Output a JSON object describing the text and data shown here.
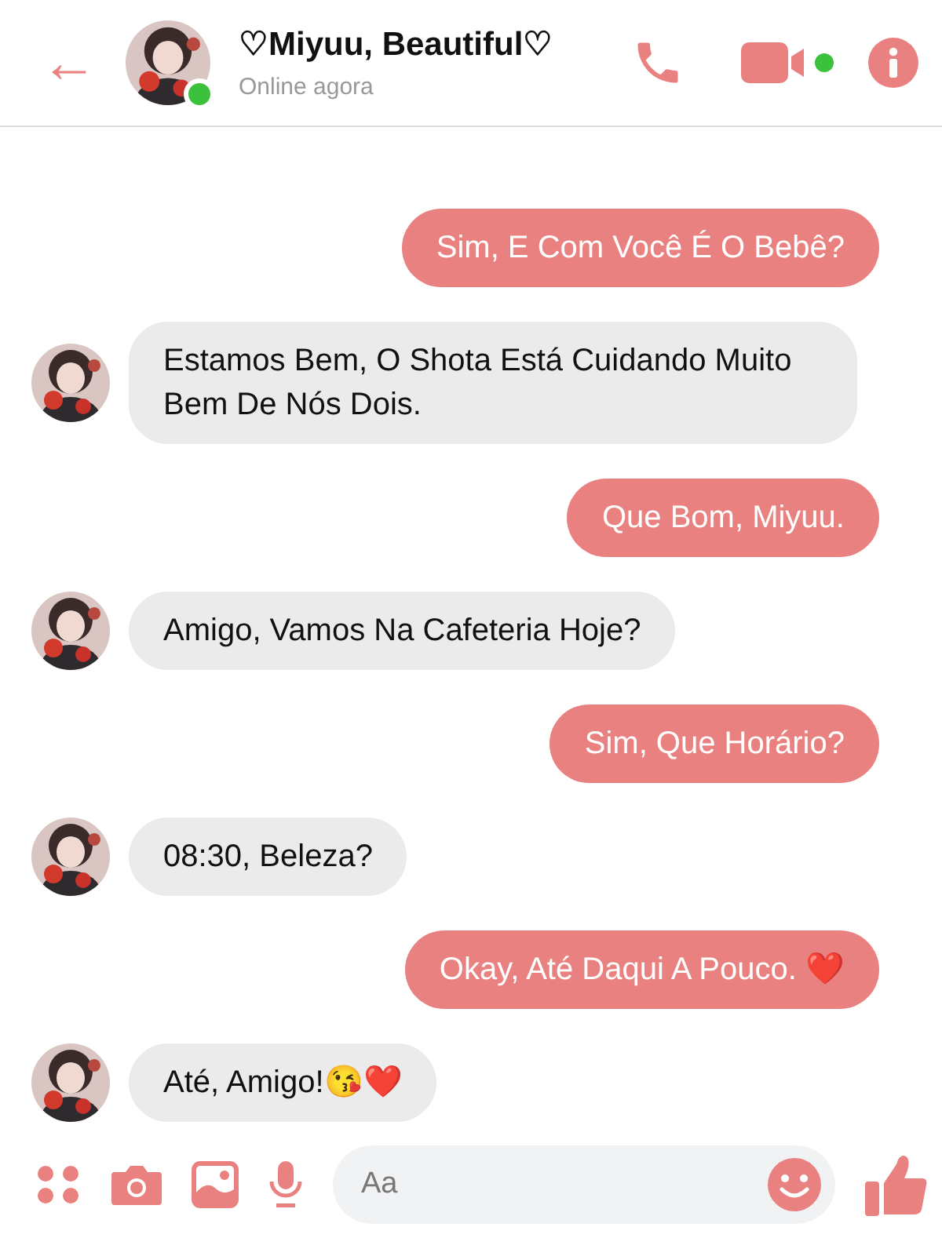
{
  "header": {
    "back": "←",
    "name": "♡Miyuu, Beautiful♡",
    "status": "Online agora",
    "online": true,
    "video_active": true
  },
  "messages": [
    {
      "kind": "sent",
      "text": "Sim, E Com Você É O Bebê?"
    },
    {
      "kind": "received",
      "text": "Estamos Bem, O Shota Está Cuidando Muito Bem De Nós Dois."
    },
    {
      "kind": "sent",
      "text": "Que Bom, Miyuu."
    },
    {
      "kind": "received",
      "text": "Amigo, Vamos Na Cafeteria Hoje?"
    },
    {
      "kind": "sent",
      "text": "Sim, Que Horário?"
    },
    {
      "kind": "received",
      "text": "08:30, Beleza?"
    },
    {
      "kind": "sent",
      "text": "Okay, Até Daqui A Pouco. ❤️"
    },
    {
      "kind": "received",
      "text": "Até, Amigo!😘❤️"
    }
  ],
  "composer": {
    "placeholder": "Aa"
  }
}
